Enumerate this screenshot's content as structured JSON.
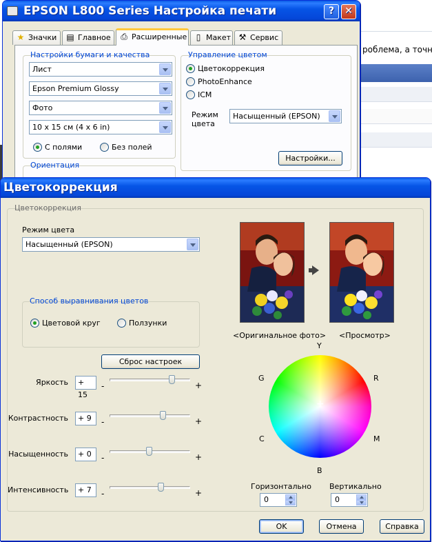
{
  "background_app": {
    "partial_text": "роблема, а точнее"
  },
  "print_settings": {
    "title": "EPSON L800 Series Настройка печати",
    "help_label": "?",
    "close_label": "✕",
    "tabs": [
      {
        "label": "Значки"
      },
      {
        "label": "Главное"
      },
      {
        "label": "Расширенные"
      },
      {
        "label": "Макет"
      },
      {
        "label": "Сервис"
      }
    ],
    "paper_group": {
      "label": "Настройки бумаги и качества",
      "paper_size": "Лист",
      "paper_type": "Epson Premium Glossy",
      "quality": "Фото",
      "size": "10 x 15 см (4 x 6 in)",
      "margins_options": [
        "С полями",
        "Без полей"
      ]
    },
    "orientation_group": {
      "label": "Ориентация"
    },
    "color_group": {
      "label": "Управление цветом",
      "options": [
        "Цветокоррекция",
        "PhotoEnhance",
        "ICM"
      ],
      "mode_label_line1": "Режим",
      "mode_label_line2": "цвета",
      "mode_value": "Насыщенный (EPSON)",
      "settings_button": "Настройки..."
    }
  },
  "color_correction": {
    "title": "Цветокоррекция",
    "group_label": "Цветокоррекция",
    "color_mode_label": "Режим цвета",
    "color_mode_value": "Насыщенный (EPSON)",
    "alignment_group": {
      "label": "Способ выравнивания цветов",
      "options": [
        "Цветовой круг",
        "Ползунки"
      ]
    },
    "reset_button": "Сброс настроек",
    "sliders": [
      {
        "label": "Яркость",
        "value": "+ 15",
        "fraction": 0.77
      },
      {
        "label": "Контрастность",
        "value": "+ 9",
        "fraction": 0.66
      },
      {
        "label": "Насыщенность",
        "value": "+ 0",
        "fraction": 0.49
      },
      {
        "label": "Интенсивность",
        "value": "+ 7",
        "fraction": 0.63
      }
    ],
    "slider_minus": "-",
    "slider_plus": "+",
    "original_caption": "<Оригинальное фото>",
    "preview_caption": "<Просмотр>",
    "wheel_labels": {
      "y": "Y",
      "r": "R",
      "m": "M",
      "b": "B",
      "c": "C",
      "g": "G"
    },
    "horizontal_label": "Горизонтально",
    "horizontal_value": "0",
    "vertical_label": "Вертикально",
    "vertical_value": "0",
    "buttons": {
      "ok": "OK",
      "cancel": "Отмена",
      "help": "Справка"
    }
  }
}
